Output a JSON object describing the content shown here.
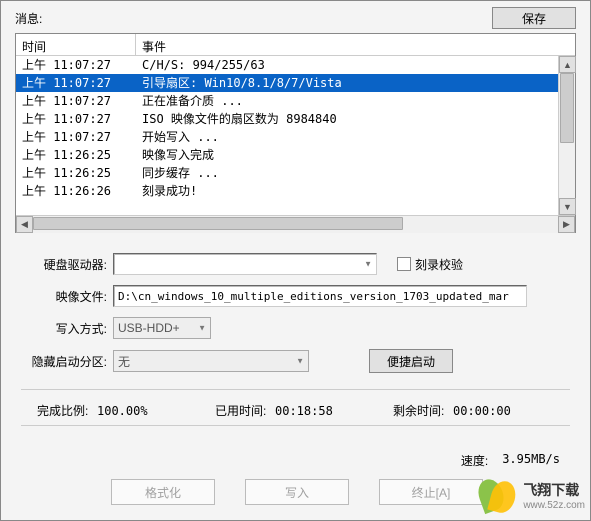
{
  "topbar": {
    "message_label": "消息:",
    "save_label": "保存"
  },
  "log": {
    "col_time": "时间",
    "col_event": "事件",
    "rows": [
      {
        "time": "上午 11:07:27",
        "event": "C/H/S: 994/255/63",
        "selected": false
      },
      {
        "time": "上午 11:07:27",
        "event": "引导扇区: Win10/8.1/8/7/Vista",
        "selected": true
      },
      {
        "time": "上午 11:07:27",
        "event": "正在准备介质 ...",
        "selected": false
      },
      {
        "time": "上午 11:07:27",
        "event": "ISO 映像文件的扇区数为 8984840",
        "selected": false
      },
      {
        "time": "上午 11:07:27",
        "event": "开始写入 ...",
        "selected": false
      },
      {
        "time": "上午 11:26:25",
        "event": "映像写入完成",
        "selected": false
      },
      {
        "time": "上午 11:26:25",
        "event": "同步缓存 ...",
        "selected": false
      },
      {
        "time": "上午 11:26:26",
        "event": "刻录成功!",
        "selected": false
      }
    ]
  },
  "form": {
    "drive_label": "硬盘驱动器:",
    "drive_value": "",
    "verify_label": "刻录校验",
    "image_label": "映像文件:",
    "image_value": "D:\\cn_windows_10_multiple_editions_version_1703_updated_mar",
    "writemode_label": "写入方式:",
    "writemode_value": "USB-HDD+",
    "hidepart_label": "隐藏启动分区:",
    "hidepart_value": "无",
    "quickboot_label": "便捷启动"
  },
  "progress": {
    "ratio_label": "完成比例:",
    "ratio_value": "100.00%",
    "elapsed_label": "已用时间:",
    "elapsed_value": "00:18:58",
    "remain_label": "剩余时间:",
    "remain_value": "00:00:00"
  },
  "speed": {
    "label": "速度:",
    "value": "3.95MB/s"
  },
  "buttons": {
    "format": "格式化",
    "write": "写入",
    "stop": "终止[A]"
  },
  "watermark": {
    "line1": "飞翔下载",
    "line2": "www.52z.com"
  }
}
